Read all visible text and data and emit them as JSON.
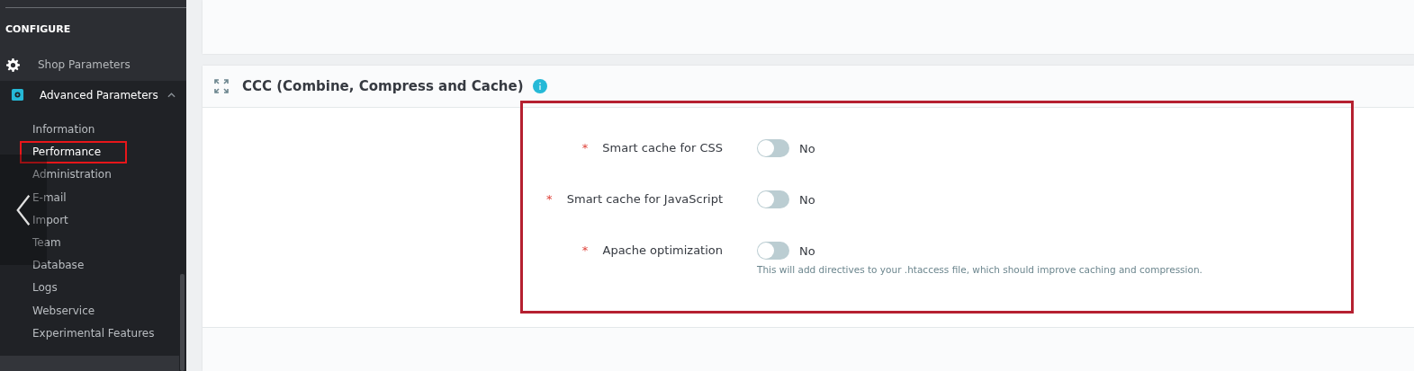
{
  "sidebar": {
    "section_title": "CONFIGURE",
    "items": [
      {
        "label": "Shop Parameters",
        "expanded": false
      },
      {
        "label": "Advanced Parameters",
        "expanded": true,
        "children": [
          {
            "label": "Information",
            "selected": false,
            "highlighted": false
          },
          {
            "label": "Performance",
            "selected": true,
            "highlighted": true
          },
          {
            "label": "Administration",
            "selected": false,
            "highlighted": false
          },
          {
            "label": "E-mail",
            "selected": false,
            "highlighted": false
          },
          {
            "label": "Import",
            "selected": false,
            "highlighted": false
          },
          {
            "label": "Team",
            "selected": false,
            "highlighted": false
          },
          {
            "label": "Database",
            "selected": false,
            "highlighted": false
          },
          {
            "label": "Logs",
            "selected": false,
            "highlighted": false
          },
          {
            "label": "Webservice",
            "selected": false,
            "highlighted": false
          },
          {
            "label": "Experimental Features",
            "selected": false,
            "highlighted": false
          }
        ]
      }
    ]
  },
  "panel": {
    "title": "CCC (Combine, Compress and Cache)",
    "highlighted": true,
    "fields": [
      {
        "label": "Smart cache for CSS",
        "required_mark": "*",
        "on": false,
        "value": "No"
      },
      {
        "label": "Smart cache for JavaScript",
        "required_mark": "*",
        "on": false,
        "value": "No"
      },
      {
        "label": "Apache optimization",
        "required_mark": "*",
        "on": false,
        "value": "No",
        "help": "This will add directives to your .htaccess file, which should improve caching and compression."
      }
    ]
  }
}
